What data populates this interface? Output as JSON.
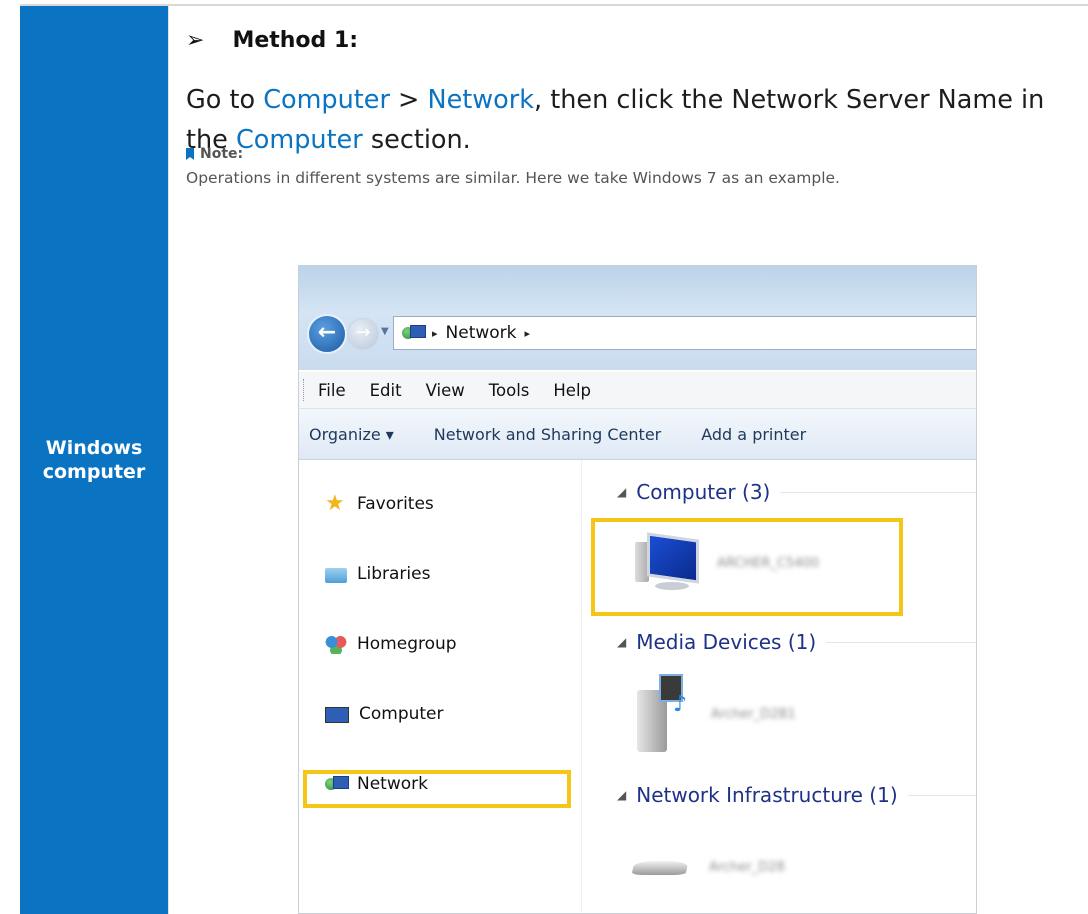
{
  "side": {
    "label": "Windows computer"
  },
  "method": {
    "arrow": "➢",
    "title": "Method 1:"
  },
  "instruction": {
    "p1": "Go to ",
    "link1": "Computer",
    "p2": " > ",
    "link2": "Network",
    "p3": ", then click the Network Server Name in the ",
    "link3": "Computer",
    "p4": " section."
  },
  "note": {
    "label": "Note:",
    "text": "Operations in different systems are similar. Here we take Windows 7 as an example."
  },
  "explorer": {
    "address": {
      "location": "Network",
      "sep": "▸"
    },
    "menu": [
      "File",
      "Edit",
      "View",
      "Tools",
      "Help"
    ],
    "commands": [
      "Organize ▾",
      "Network and Sharing Center",
      "Add a printer"
    ],
    "nav": [
      "Favorites",
      "Libraries",
      "Homegroup",
      "Computer",
      "Network"
    ],
    "groups": [
      {
        "title": "Computer (3)",
        "device": "ARCHER_C5400"
      },
      {
        "title": "Media Devices (1)",
        "device": "Archer_D2B1"
      },
      {
        "title": "Network Infrastructure (1)",
        "device": "Archer_D28"
      }
    ],
    "collapse_glyph": "◢"
  },
  "colors": {
    "accent": "#0a74c2",
    "highlight": "#f5c518"
  }
}
